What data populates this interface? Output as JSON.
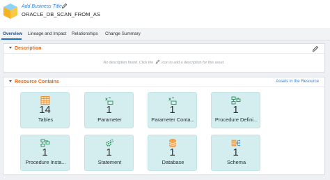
{
  "header": {
    "business_title_placeholder": "Add Business Title",
    "asset_name": "ORACLE_DB_SCAN_FROM_AS"
  },
  "tabs": [
    {
      "label": "Overview",
      "active": true
    },
    {
      "label": "Lineage and Impact",
      "active": false
    },
    {
      "label": "Relationships",
      "active": false
    },
    {
      "label": "Change Summary",
      "active": false
    }
  ],
  "description": {
    "title": "Description",
    "empty_before": "No description found. Click the",
    "empty_after": "icon to add a description for this asset."
  },
  "resource": {
    "title": "Resource Contains",
    "assets_link": "Assets in the Resource",
    "tiles": [
      {
        "count": "14",
        "label": "Tables",
        "icon": "table-icon"
      },
      {
        "count": "1",
        "label": "Parameter",
        "icon": "parameter-icon"
      },
      {
        "count": "1",
        "label": "Parameter Conta...",
        "icon": "parameter-container-icon"
      },
      {
        "count": "1",
        "label": "Procedure Defini...",
        "icon": "procedure-definition-icon"
      },
      {
        "count": "1",
        "label": "Procedure Insta...",
        "icon": "procedure-instance-icon"
      },
      {
        "count": "1",
        "label": "Statement",
        "icon": "statement-icon"
      },
      {
        "count": "1",
        "label": "Database",
        "icon": "database-icon"
      },
      {
        "count": "1",
        "label": "Schema",
        "icon": "schema-icon"
      }
    ]
  },
  "colors": {
    "accent_blue": "#2f7fd1",
    "section_orange": "#e36a1c",
    "tile_bg": "#d4eef0",
    "icon_green": "#2e8b57",
    "icon_orange": "#f08a24"
  }
}
